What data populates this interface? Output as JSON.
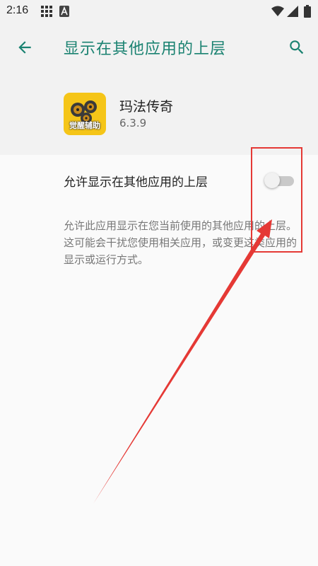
{
  "status_bar": {
    "time": "2:16",
    "icons": [
      "grid-icon",
      "a-icon",
      "wifi-icon",
      "signal-icon",
      "battery-icon"
    ]
  },
  "app_bar": {
    "title": "显示在其他应用的上层",
    "icons": [
      "back-arrow-icon",
      "search-icon"
    ]
  },
  "app": {
    "name": "玛法传奇",
    "version": "6.3.9",
    "icon_label": "觉醒辅助"
  },
  "setting": {
    "label": "允许显示在其他应用的上层",
    "enabled": false,
    "description": "允许此应用显示在您当前使用的其他应用的上层。这可能会干扰您使用相关应用，或变更这类应用的显示或运行方式。"
  },
  "colors": {
    "accent": "#1a8271",
    "annotation": "#e53935",
    "app_icon_bg": "#f5c518"
  }
}
